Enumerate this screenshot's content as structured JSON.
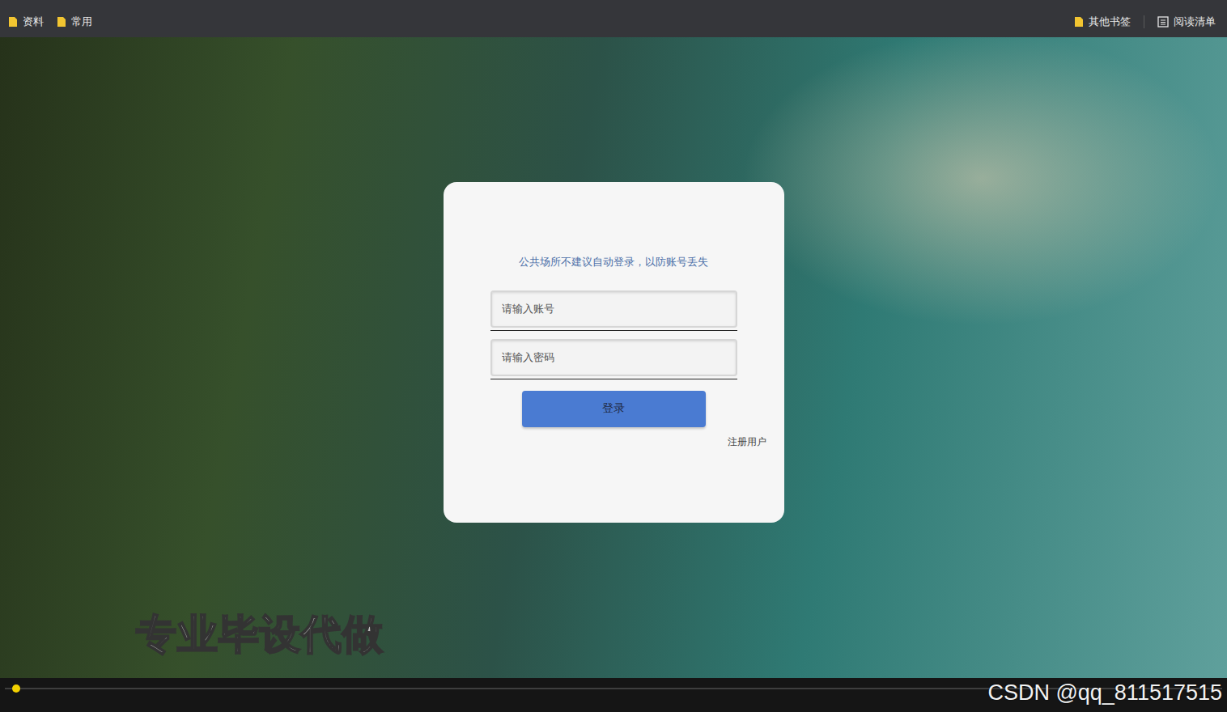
{
  "bookmarks_bar": {
    "left": [
      {
        "label": "资料"
      },
      {
        "label": "常用"
      }
    ],
    "right": [
      {
        "label": "其他书签",
        "kind": "folder"
      },
      {
        "label": "阅读清单",
        "kind": "list"
      }
    ]
  },
  "login": {
    "notice": "公共场所不建议自动登录，以防账号丢失",
    "fields": [
      {
        "placeholder": "请输入账号",
        "kind": "text"
      },
      {
        "placeholder": "请输入密码",
        "kind": "password"
      }
    ],
    "submit": "登录",
    "register": "注册用户"
  },
  "watermarks": {
    "overlay": "专业毕设代做",
    "credit": "CSDN @qq_811517515"
  },
  "player": {
    "level": 0.005
  }
}
